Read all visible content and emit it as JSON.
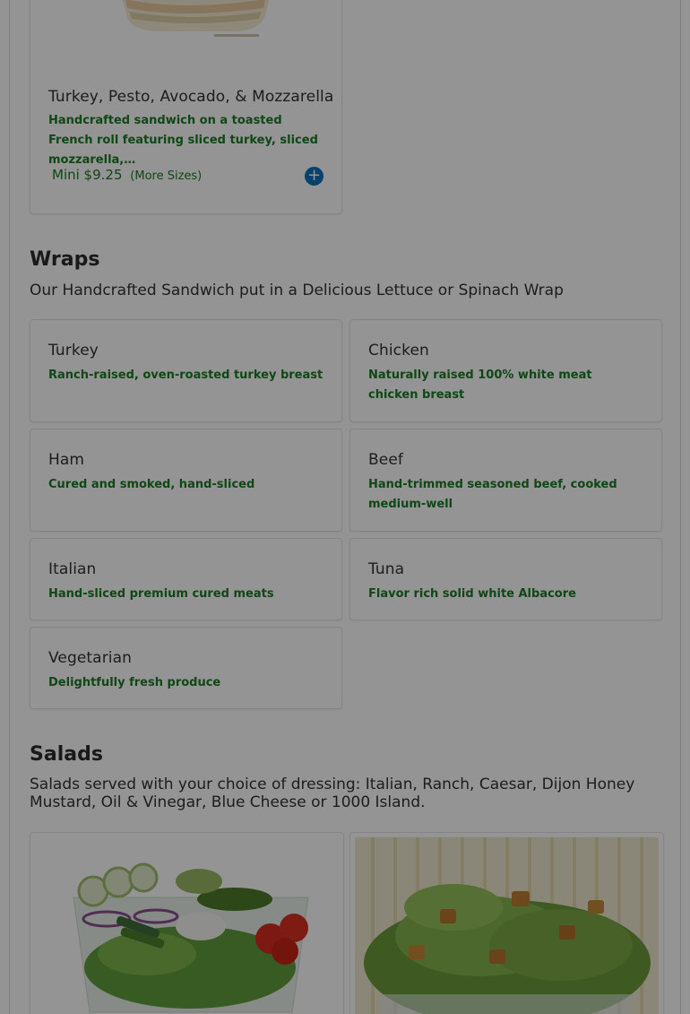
{
  "colors": {
    "accent_green": "#1b7a25",
    "add_button_blue": "#0b73b8",
    "overlay": "rgba(0,0,0,0.42)"
  },
  "sandwich_card": {
    "title": "Turkey, Pesto, Avocado, & Mozzarella",
    "description": "Handcrafted sandwich on a toasted French roll featuring sliced turkey, sliced mozzarella,…",
    "price": "Mini $9.25",
    "more_sizes": "(More Sizes)",
    "add_icon": "plus-icon",
    "add_symbol": "+"
  },
  "wraps": {
    "title": "Wraps",
    "subtitle": "Our Handcrafted Sandwich put in a Delicious Lettuce or Spinach Wrap",
    "items": [
      {
        "name": "Turkey",
        "desc": "Ranch-raised, oven-roasted turkey breast"
      },
      {
        "name": "Chicken",
        "desc": "Naturally raised 100% white meat chicken breast"
      },
      {
        "name": "Ham",
        "desc": "Cured and smoked, hand-sliced"
      },
      {
        "name": "Beef",
        "desc": "Hand-trimmed seasoned beef, cooked medium-well"
      },
      {
        "name": "Italian",
        "desc": "Hand-sliced premium cured meats"
      },
      {
        "name": "Tuna",
        "desc": "Flavor rich solid white Albacore"
      },
      {
        "name": "Vegetarian",
        "desc": "Delightfully fresh produce"
      }
    ]
  },
  "salads": {
    "title": "Salads",
    "subtitle": "Salads served with your choice of dressing: Italian, Ranch, Caesar, Dijon Honey Mustard, Oil & Vinegar, Blue Cheese or 1000 Island."
  }
}
